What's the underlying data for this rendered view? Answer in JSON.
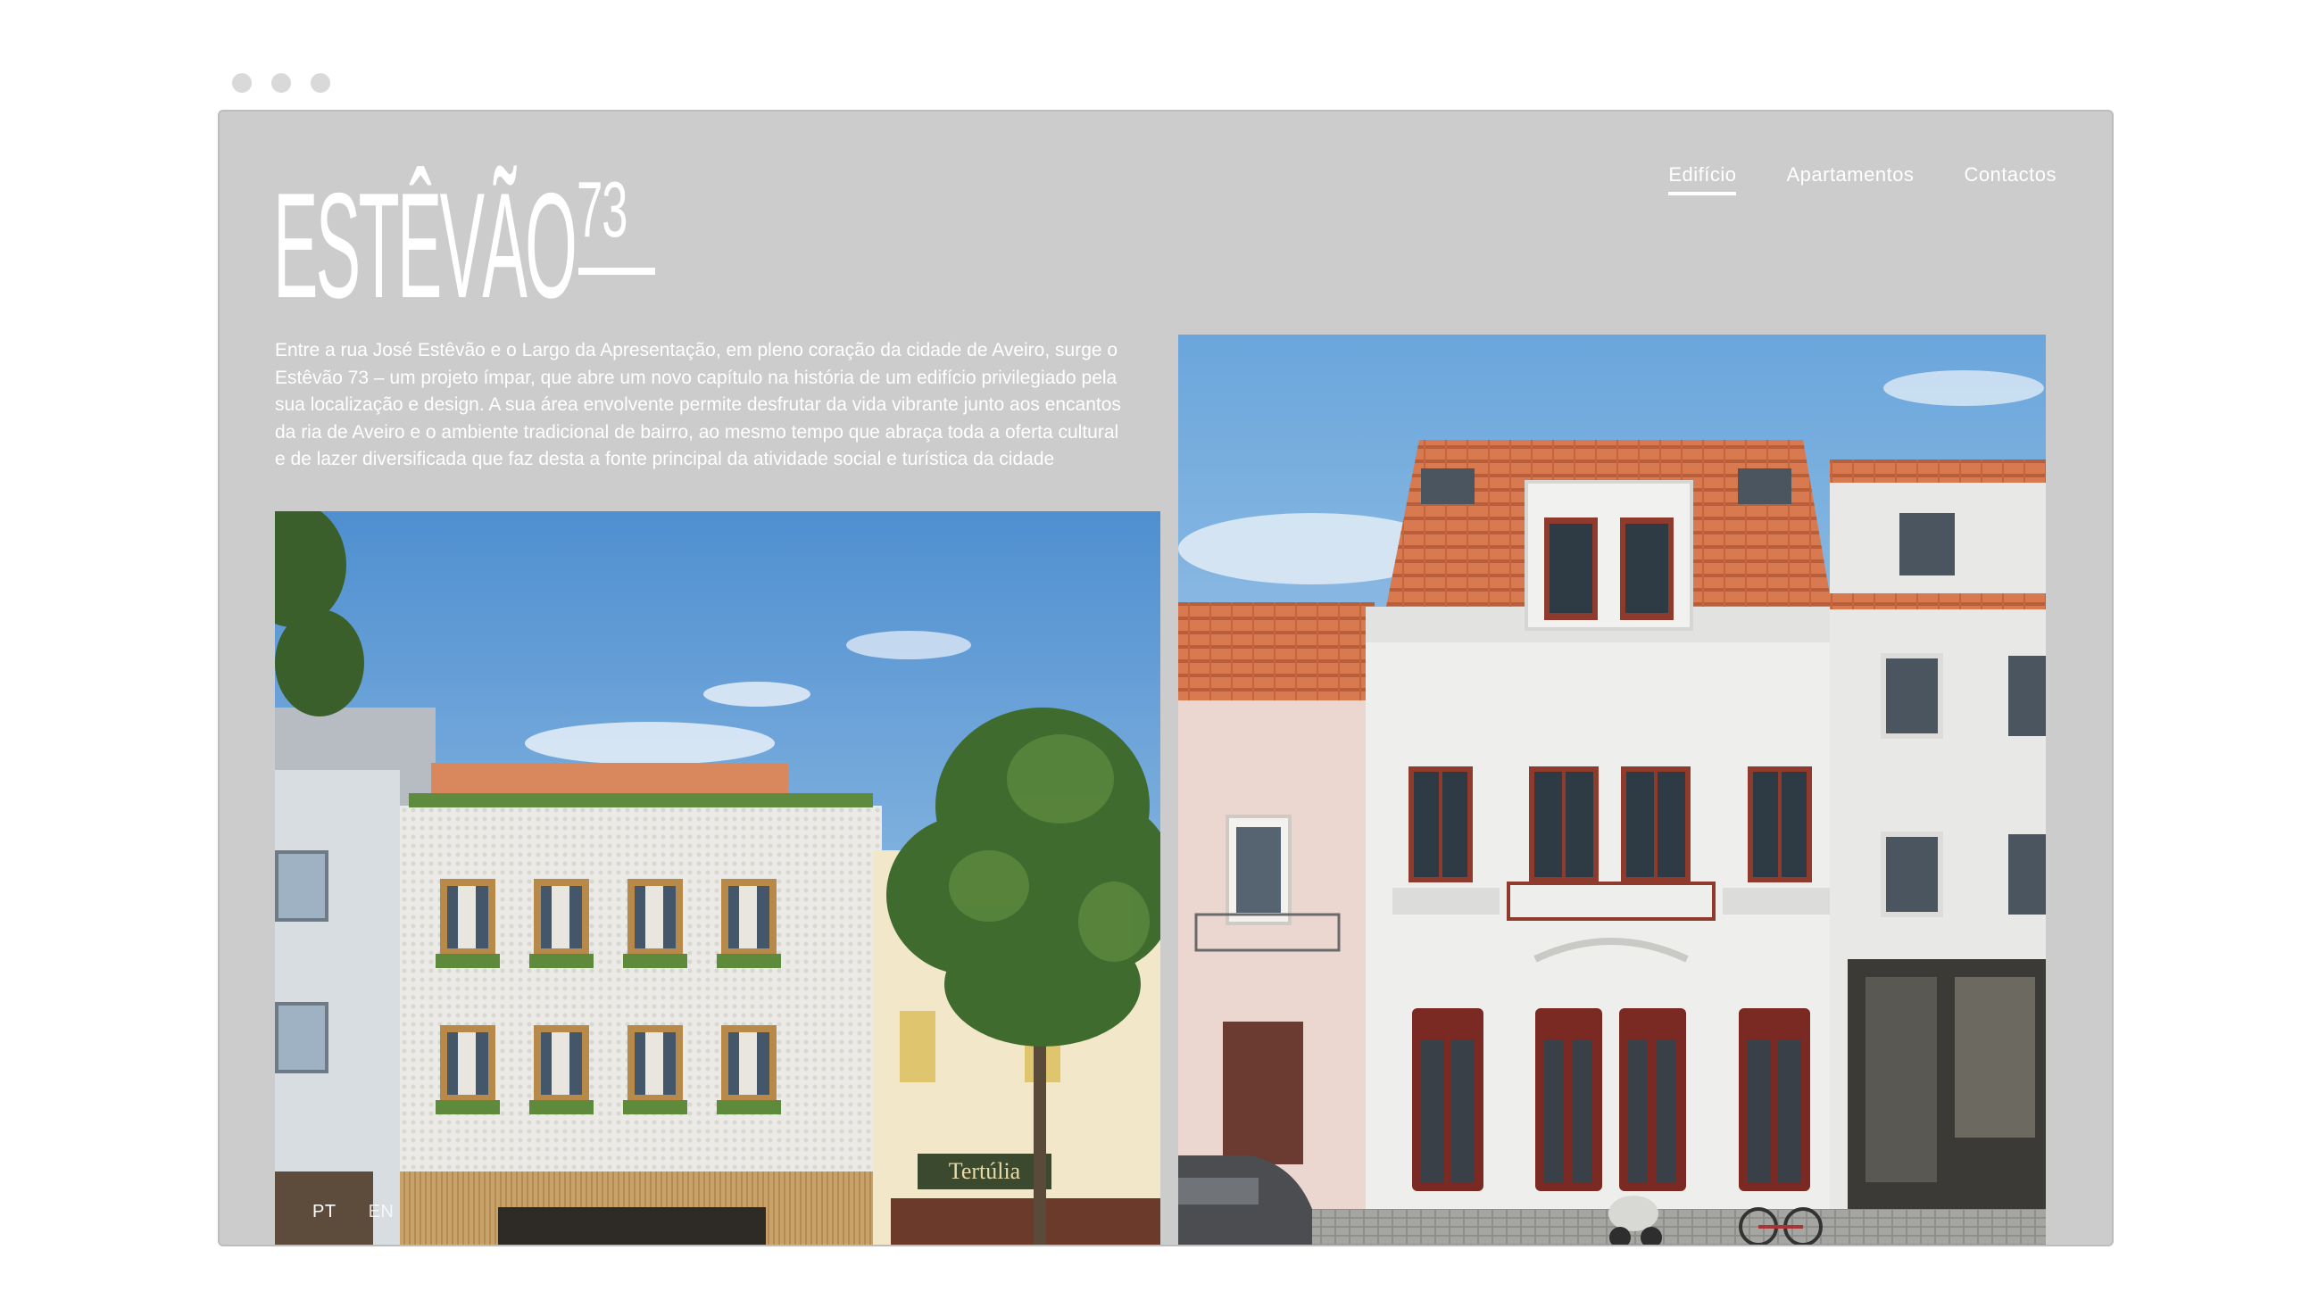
{
  "window": {
    "background_color": "#cccccc",
    "accent_color": "#ffffff"
  },
  "logo": {
    "word": "ESTÊVÃO",
    "number": "73"
  },
  "nav": {
    "items": [
      {
        "label": "Edifício",
        "active": true
      },
      {
        "label": "Apartamentos",
        "active": false
      },
      {
        "label": "Contactos",
        "active": false
      }
    ]
  },
  "intro": {
    "text": "Entre a rua José Estêvão e o Largo da Apresentação, em pleno coração da cidade de Aveiro, surge o Estêvão 73 – um projeto ímpar, que abre um novo capítulo na história de um edifício privilegiado pela sua localização e design. A sua área envolvente permite desfrutar da vida vibrante junto aos encantos da ria de Aveiro e o ambiente tradicional de bairro, ao mesmo tempo que abraça toda a oferta cultural e de lazer diversificada que faz desta a fonte principal da atividade social e turística da cidade"
  },
  "photos": {
    "left_sign": "Tertúlia"
  },
  "language": {
    "items": [
      {
        "label": "PT",
        "active": true
      },
      {
        "label": "EN",
        "active": false
      }
    ]
  }
}
